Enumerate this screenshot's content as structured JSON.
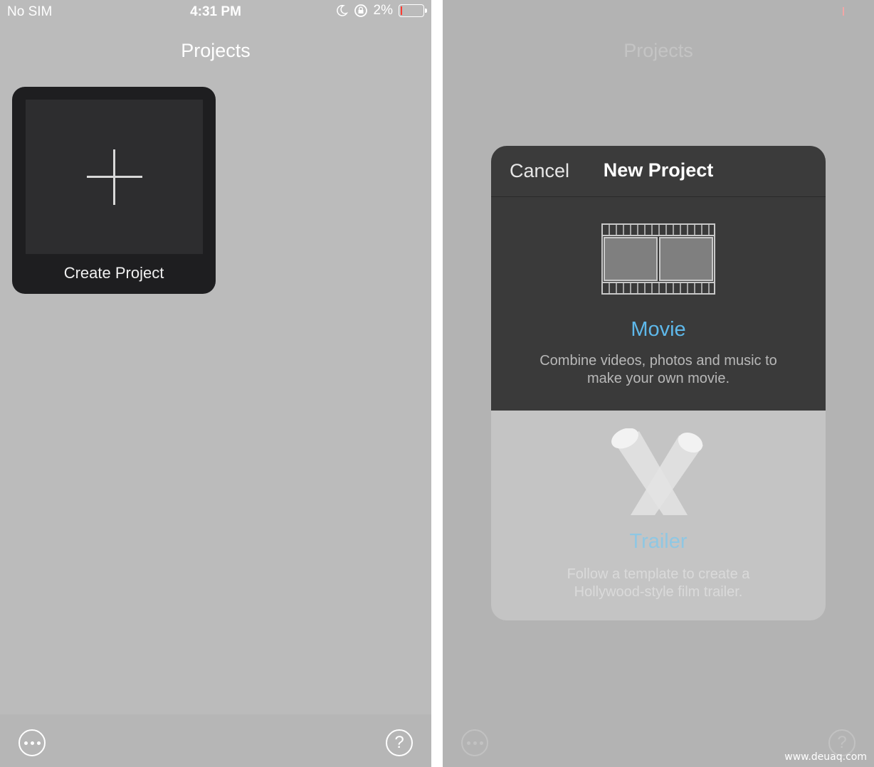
{
  "status_bar": {
    "carrier": "No SIM",
    "time": "4:31 PM",
    "battery": "2%"
  },
  "left": {
    "title": "Projects",
    "create_project_label": "Create Project",
    "help_label": "?"
  },
  "right": {
    "title": "Projects",
    "help_label": "?",
    "modal": {
      "cancel_label": "Cancel",
      "title": "New Project",
      "movie": {
        "label": "Movie",
        "description": "Combine videos, photos and music to make your own movie."
      },
      "trailer": {
        "label": "Trailer",
        "description": "Follow a template to create a Hollywood-style film trailer."
      }
    }
  },
  "watermark": "www.deuaq.com",
  "colors": {
    "accent": "#5eb8ea",
    "card_dark": "#1e1e20",
    "modal_dark": "#3a3a3a"
  }
}
